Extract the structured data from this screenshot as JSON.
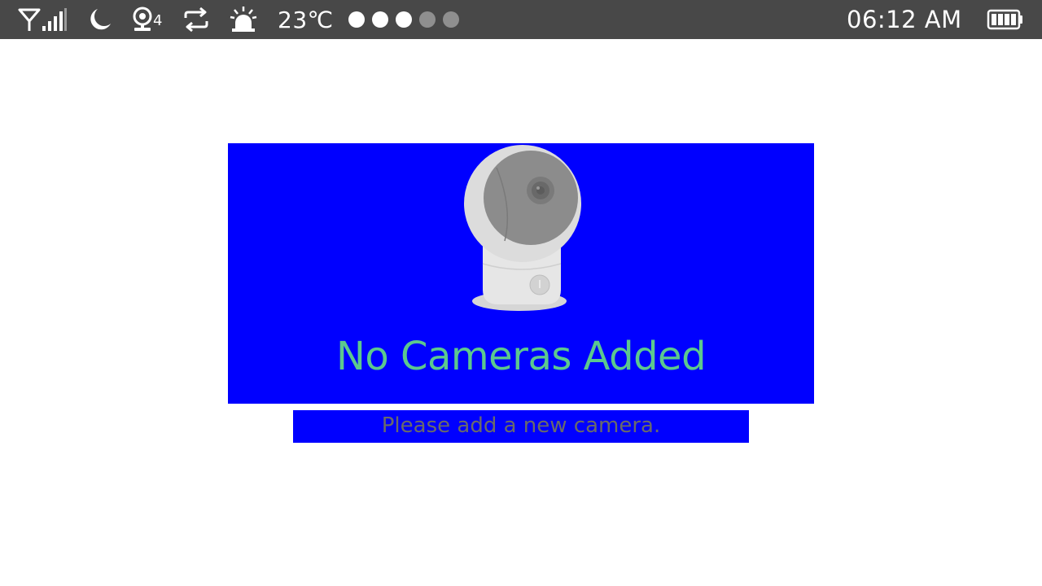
{
  "status_bar": {
    "icons": [
      "wifi-signal-icon",
      "moon-icon",
      "camera-icon",
      "repeat-icon",
      "alarm-icon",
      "battery-icon"
    ],
    "camera_count": "4",
    "temperature": "23℃",
    "page_dots": {
      "total": 5,
      "active": 3
    },
    "time": "06:12 AM",
    "battery_level": 1.0
  },
  "empty_state": {
    "illustration": "camera-illustration",
    "title": "No Cameras Added",
    "subtitle": "Please add a new camera."
  },
  "colors": {
    "status_bar_bg": "#484848",
    "panel_bg": "#0000ff",
    "title": "#5cc88e",
    "subtitle": "#6a6a6a"
  }
}
